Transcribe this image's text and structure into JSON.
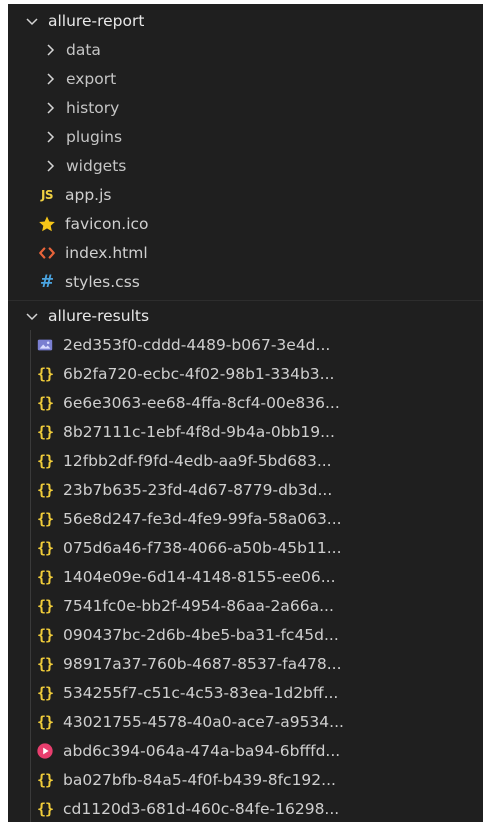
{
  "explorer": {
    "folders": [
      {
        "name": "allure-report",
        "expanded": true,
        "children": [
          {
            "name": "data",
            "kind": "folder"
          },
          {
            "name": "export",
            "kind": "folder"
          },
          {
            "name": "history",
            "kind": "folder"
          },
          {
            "name": "plugins",
            "kind": "folder"
          },
          {
            "name": "widgets",
            "kind": "folder"
          },
          {
            "name": "app.js",
            "kind": "file",
            "icon": "javascript-file-icon"
          },
          {
            "name": "favicon.ico",
            "kind": "file",
            "icon": "star-icon"
          },
          {
            "name": "index.html",
            "kind": "file",
            "icon": "html-file-icon"
          },
          {
            "name": "styles.css",
            "kind": "file",
            "icon": "css-file-icon"
          }
        ]
      },
      {
        "name": "allure-results",
        "expanded": true,
        "children": [
          {
            "name": "2ed353f0-cddd-4489-b067-3e4d...",
            "kind": "file",
            "icon": "image-file-icon"
          },
          {
            "name": "6b2fa720-ecbc-4f02-98b1-334b3...",
            "kind": "file",
            "icon": "json-file-icon"
          },
          {
            "name": "6e6e3063-ee68-4ffa-8cf4-00e836...",
            "kind": "file",
            "icon": "json-file-icon"
          },
          {
            "name": "8b27111c-1ebf-4f8d-9b4a-0bb19...",
            "kind": "file",
            "icon": "json-file-icon"
          },
          {
            "name": "12fbb2df-f9fd-4edb-aa9f-5bd683...",
            "kind": "file",
            "icon": "json-file-icon"
          },
          {
            "name": "23b7b635-23fd-4d67-8779-db3d...",
            "kind": "file",
            "icon": "json-file-icon"
          },
          {
            "name": "56e8d247-fe3d-4fe9-99fa-58a063...",
            "kind": "file",
            "icon": "json-file-icon"
          },
          {
            "name": "075d6a46-f738-4066-a50b-45b11...",
            "kind": "file",
            "icon": "json-file-icon"
          },
          {
            "name": "1404e09e-6d14-4148-8155-ee06...",
            "kind": "file",
            "icon": "json-file-icon"
          },
          {
            "name": "7541fc0e-bb2f-4954-86aa-2a66a...",
            "kind": "file",
            "icon": "json-file-icon"
          },
          {
            "name": "090437bc-2d6b-4be5-ba31-fc45d...",
            "kind": "file",
            "icon": "json-file-icon"
          },
          {
            "name": "98917a37-760b-4687-8537-fa478...",
            "kind": "file",
            "icon": "json-file-icon"
          },
          {
            "name": "534255f7-c51c-4c53-83ea-1d2bff...",
            "kind": "file",
            "icon": "json-file-icon"
          },
          {
            "name": "43021755-4578-40a0-ace7-a9534...",
            "kind": "file",
            "icon": "json-file-icon"
          },
          {
            "name": "abd6c394-064a-474a-ba94-6bfffd...",
            "kind": "file",
            "icon": "video-file-icon"
          },
          {
            "name": "ba027bfb-84a5-4f0f-b439-8fc192...",
            "kind": "file",
            "icon": "json-file-icon"
          },
          {
            "name": "cd1120d3-681d-460c-84fe-16298...",
            "kind": "file",
            "icon": "json-file-icon"
          }
        ]
      }
    ]
  },
  "colors": {
    "panel_background": "#1f1f1f",
    "js_icon": "#f0d143",
    "star_icon": "#f5c518",
    "html_icon": "#e8643a",
    "css_icon": "#4aa3df",
    "json_icon": "#f0cc3a",
    "image_icon": "#7a7fd1",
    "video_icon": "#e83e6e"
  }
}
